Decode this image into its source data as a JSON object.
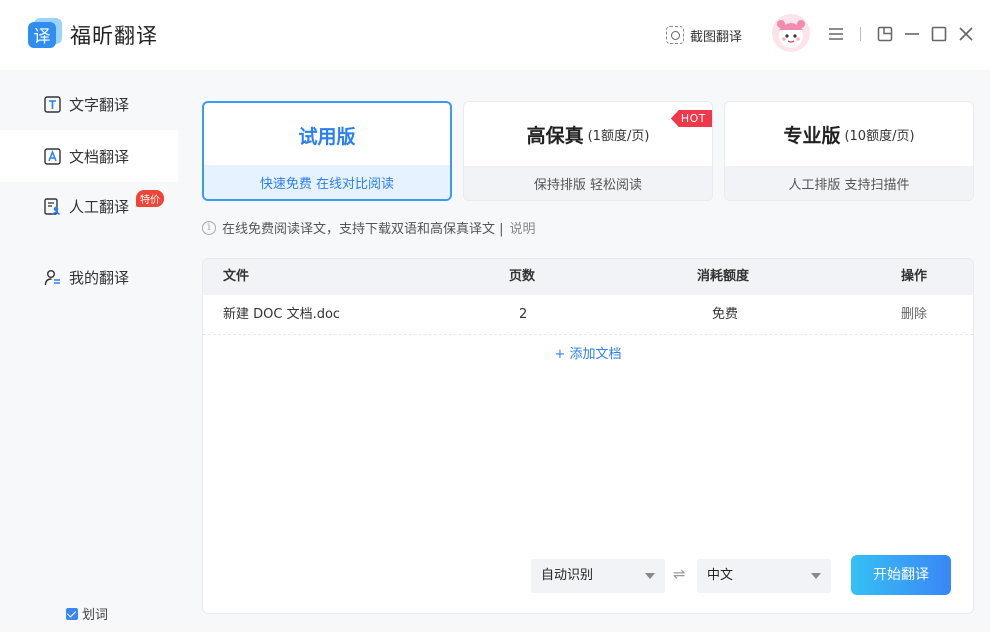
{
  "app": {
    "title": "福昕翻译",
    "logo_char": "译"
  },
  "titlebar": {
    "screenshot_label": "截图翻译"
  },
  "sidebar": {
    "items": [
      {
        "label": "文字翻译",
        "icon": "text-translate-icon"
      },
      {
        "label": "文档翻译",
        "icon": "doc-translate-icon"
      },
      {
        "label": "人工翻译",
        "icon": "human-translate-icon",
        "badge": "特价"
      },
      {
        "label": "我的翻译",
        "icon": "my-translate-icon"
      }
    ],
    "word_pick": {
      "label": "划词",
      "checked": true
    }
  },
  "plans": [
    {
      "name": "试用版",
      "quota": "",
      "sub": "快速免费 在线对比阅读",
      "active": true
    },
    {
      "name": "高保真",
      "quota": "(1额度/页)",
      "sub": "保持排版 轻松阅读",
      "badge": "HOT"
    },
    {
      "name": "专业版",
      "quota": "(10额度/页)",
      "sub": "人工排版 支持扫描件"
    }
  ],
  "info": {
    "text": "在线免费阅读译文，支持下载双语和高保真译文 |",
    "link": "说明"
  },
  "table": {
    "headers": {
      "file": "文件",
      "pages": "页数",
      "cost": "消耗额度",
      "action": "操作"
    },
    "rows": [
      {
        "file": "新建 DOC 文档.doc",
        "pages": "2",
        "cost": "免费",
        "action": "删除"
      }
    ],
    "add_label": "+ 添加文档"
  },
  "translate": {
    "source_lang": "自动识别",
    "target_lang": "中文",
    "start_label": "开始翻译"
  },
  "colors": {
    "accent": "#2b7fef",
    "hot": "#f0384a",
    "badge": "#f04438"
  }
}
